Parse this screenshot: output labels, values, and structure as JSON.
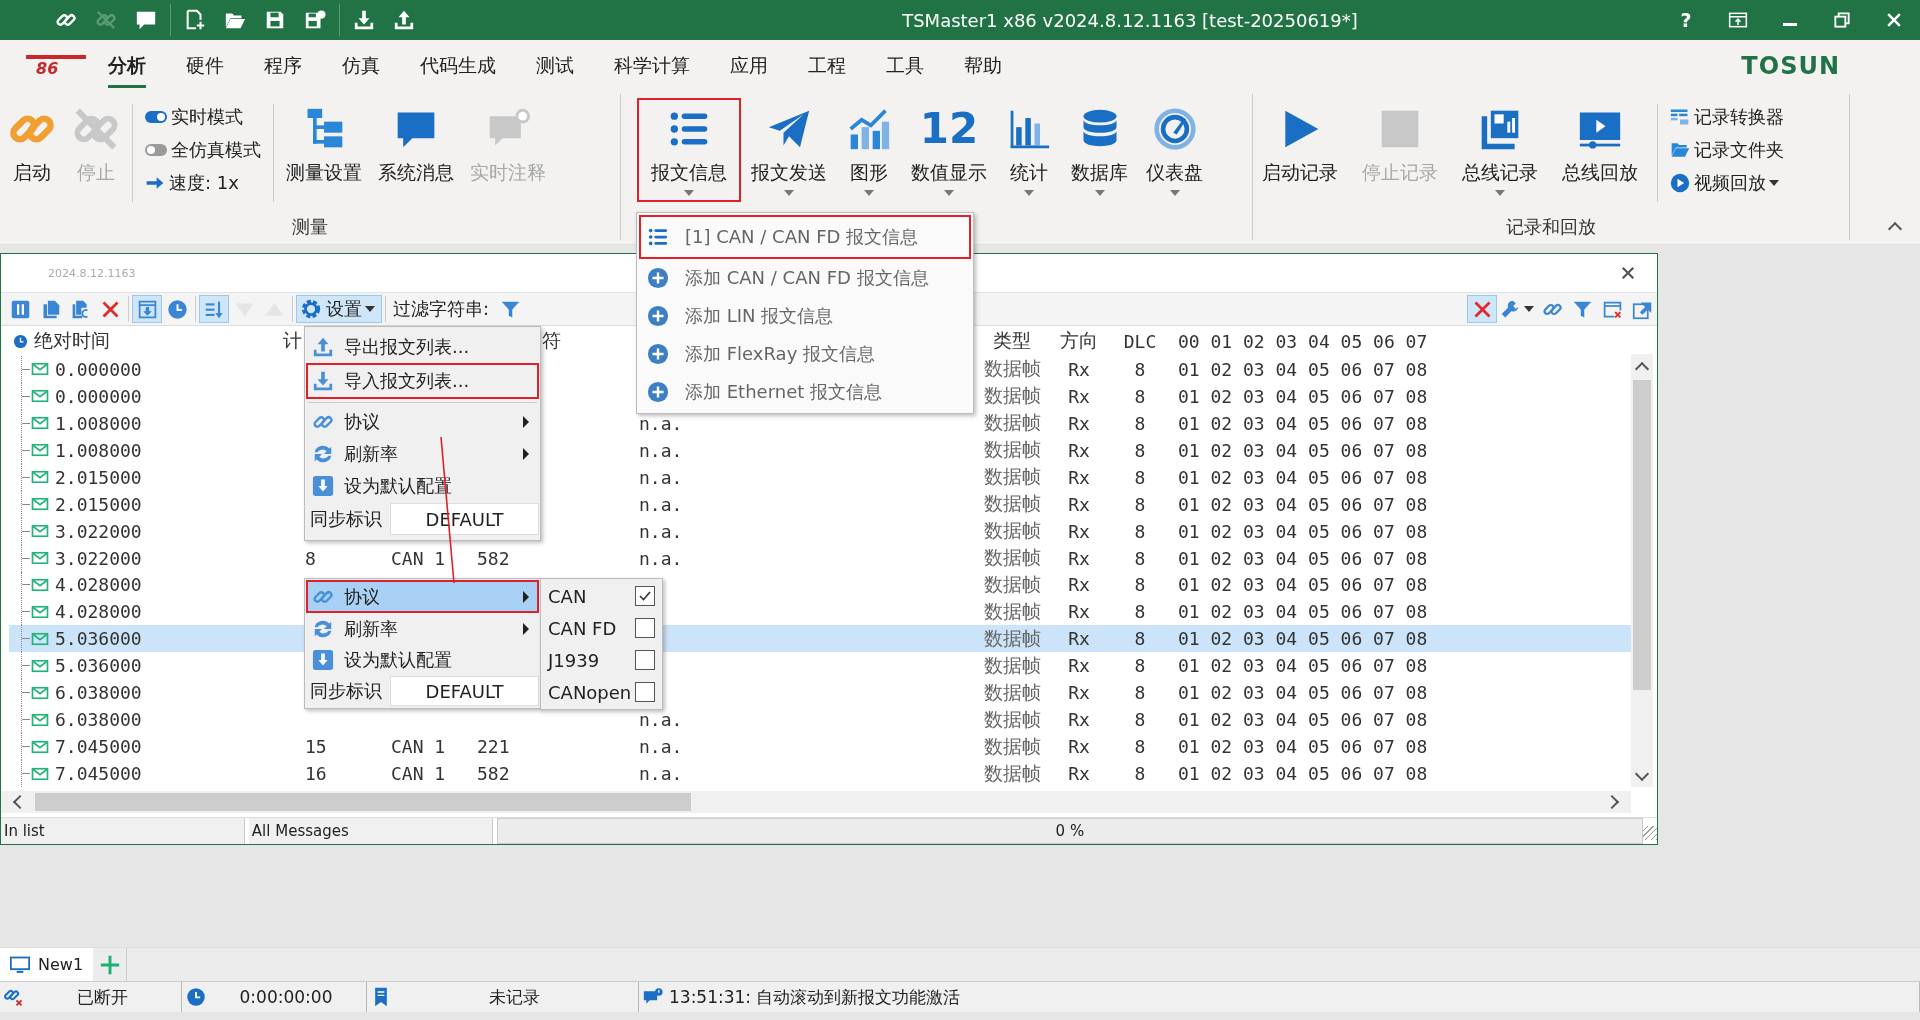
{
  "window": {
    "title": "TSMaster1 x86 v2024.8.12.1163 [test-20250619*]",
    "quick_access": [
      [
        {
          "kind": "link",
          "disabled": false
        },
        {
          "kind": "unlink",
          "disabled": true
        },
        {
          "kind": "chat",
          "disabled": false
        }
      ],
      [
        {
          "kind": "new-file",
          "disabled": false
        },
        {
          "kind": "open-folder",
          "disabled": false
        },
        {
          "kind": "save",
          "disabled": false
        },
        {
          "kind": "save-all",
          "disabled": false
        }
      ],
      [
        {
          "kind": "download",
          "disabled": false
        },
        {
          "kind": "upload",
          "disabled": false
        }
      ]
    ],
    "controls": [
      {
        "kind": "help",
        "label": "?"
      },
      {
        "kind": "pin"
      },
      {
        "kind": "minimize"
      },
      {
        "kind": "restore"
      },
      {
        "kind": "close"
      }
    ]
  },
  "menu_bar": {
    "logo_text": "86",
    "brand": "TOSUN",
    "tabs": [
      {
        "label": "分析",
        "selected": true
      },
      {
        "label": "硬件",
        "selected": false
      },
      {
        "label": "程序",
        "selected": false
      },
      {
        "label": "仿真",
        "selected": false
      },
      {
        "label": "代码生成",
        "selected": false
      },
      {
        "label": "测试",
        "selected": false
      },
      {
        "label": "科学计算",
        "selected": false
      },
      {
        "label": "应用",
        "selected": false
      },
      {
        "label": "工程",
        "selected": false
      },
      {
        "label": "工具",
        "selected": false
      },
      {
        "label": "帮助",
        "selected": false
      }
    ]
  },
  "ribbon": {
    "groups": [
      {
        "label": "测量",
        "sections": [
          [
            {
              "label": "启动",
              "kind": "link-big",
              "disabled": false,
              "dropdown": false,
              "highlighted": false
            },
            {
              "label": "停止",
              "kind": "unlink-big",
              "disabled": true,
              "dropdown": false,
              "highlighted": false
            }
          ],
          [
            {
              "entries": [
                {
                  "kind": "toggle",
                  "label": "实时模式",
                  "on": true
                },
                {
                  "kind": "toggle",
                  "label": "全仿真模式",
                  "on": false
                },
                {
                  "kind": "arrow-right",
                  "label": "速度: 1x",
                  "dropdown": false
                }
              ]
            }
          ],
          [
            {
              "label": "测量设置",
              "kind": "tree",
              "disabled": false,
              "dropdown": false,
              "highlighted": false
            },
            {
              "label": "系统消息",
              "kind": "chat",
              "disabled": false,
              "dropdown": false,
              "highlighted": false
            },
            {
              "label": "实时注释",
              "kind": "chat-info",
              "disabled": true,
              "dropdown": false,
              "highlighted": false
            }
          ]
        ]
      },
      {
        "sections": [
          [
            {
              "label": "报文信息",
              "kind": "list",
              "disabled": false,
              "dropdown": true,
              "highlighted": true
            },
            {
              "label": "报文发送",
              "kind": "plane",
              "disabled": false,
              "dropdown": true,
              "highlighted": false
            },
            {
              "label": "图形",
              "kind": "chart-line",
              "disabled": false,
              "dropdown": true,
              "highlighted": false
            },
            {
              "label": "数值显示",
              "icon_text": "12",
              "disabled": false,
              "dropdown": true,
              "highlighted": false
            },
            {
              "label": "统计",
              "kind": "bar-chart",
              "disabled": false,
              "dropdown": true,
              "highlighted": false
            },
            {
              "label": "数据库",
              "kind": "database",
              "disabled": false,
              "dropdown": true,
              "highlighted": false
            },
            {
              "label": "仪表盘",
              "kind": "gauge",
              "disabled": false,
              "dropdown": true,
              "highlighted": false
            }
          ]
        ]
      },
      {
        "label": "记录和回放",
        "sections": [
          [
            {
              "label": "启动记录",
              "kind": "play",
              "disabled": false,
              "dropdown": false,
              "highlighted": false
            },
            {
              "label": "停止记录",
              "kind": "stop",
              "disabled": true,
              "dropdown": false,
              "highlighted": false
            },
            {
              "label": "总线记录",
              "kind": "bus-record",
              "disabled": false,
              "dropdown": true,
              "highlighted": false
            },
            {
              "label": "总线回放",
              "kind": "bus-play",
              "disabled": false,
              "dropdown": false,
              "highlighted": false
            }
          ],
          [
            {
              "entries": [
                {
                  "kind": "converter",
                  "label": "记录转换器",
                  "dropdown": false
                },
                {
                  "kind": "folder",
                  "label": "记录文件夹",
                  "dropdown": false
                },
                {
                  "kind": "play-circle",
                  "label": "视频回放",
                  "dropdown": true
                }
              ]
            }
          ]
        ]
      }
    ]
  },
  "message_window": {
    "version": "2024.8.12.1163",
    "toolbar_left": [
      [
        {
          "kind": "pause",
          "pressed": false,
          "disabled": false
        },
        {
          "kind": "copy",
          "pressed": false,
          "disabled": false
        },
        {
          "kind": "copy-c",
          "pressed": false,
          "disabled": false
        },
        {
          "kind": "x",
          "pressed": false,
          "disabled": false
        }
      ],
      [
        {
          "kind": "autoscroll",
          "pressed": true,
          "disabled": false
        },
        {
          "kind": "clock",
          "pressed": false,
          "disabled": false
        }
      ],
      [
        {
          "kind": "sort",
          "pressed": true,
          "disabled": false
        },
        {
          "kind": "tri-down",
          "pressed": false,
          "disabled": true
        },
        {
          "kind": "tri-up",
          "pressed": false,
          "disabled": true
        }
      ]
    ],
    "settings_button": "设置",
    "filter_label": "过滤字符串:",
    "toolbar_right": [
      {
        "kind": "x",
        "pressed": true,
        "dropdown": false
      },
      {
        "kind": "wrench",
        "pressed": false,
        "dropdown": true
      },
      {
        "kind": "link",
        "pressed": false,
        "dropdown": false
      },
      {
        "kind": "filter",
        "pressed": false,
        "dropdown": false
      },
      {
        "kind": "window-x",
        "pressed": false,
        "dropdown": false
      },
      {
        "kind": "export",
        "pressed": false,
        "dropdown": false
      }
    ],
    "columns": {
      "time": "绝对时间",
      "count": "计",
      "name": "符",
      "type": "类型",
      "direction": "方向",
      "dlc": "DLC",
      "data": "00 01 02 03 04 05 06 07"
    },
    "rows": [
      {
        "time": "0.000000",
        "type": "数据帧",
        "direction": "Rx",
        "dlc": "8",
        "data": "01 02 03 04 05 06 07 08",
        "selected": false
      },
      {
        "time": "0.000000",
        "type": "数据帧",
        "direction": "Rx",
        "dlc": "8",
        "data": "01 02 03 04 05 06 07 08",
        "selected": false
      },
      {
        "time": "1.008000",
        "value": "n.a.",
        "type": "数据帧",
        "direction": "Rx",
        "dlc": "8",
        "data": "01 02 03 04 05 06 07 08",
        "selected": false
      },
      {
        "time": "1.008000",
        "value": "n.a.",
        "type": "数据帧",
        "direction": "Rx",
        "dlc": "8",
        "data": "01 02 03 04 05 06 07 08",
        "selected": false
      },
      {
        "time": "2.015000",
        "value": "n.a.",
        "type": "数据帧",
        "direction": "Rx",
        "dlc": "8",
        "data": "01 02 03 04 05 06 07 08",
        "selected": false
      },
      {
        "time": "2.015000",
        "value": "n.a.",
        "type": "数据帧",
        "direction": "Rx",
        "dlc": "8",
        "data": "01 02 03 04 05 06 07 08",
        "selected": false
      },
      {
        "time": "3.022000",
        "value": "n.a.",
        "type": "数据帧",
        "direction": "Rx",
        "dlc": "8",
        "data": "01 02 03 04 05 06 07 08",
        "selected": false
      },
      {
        "time": "3.022000",
        "count": "8",
        "channel": "CAN 1",
        "id": "582",
        "value": "n.a.",
        "type": "数据帧",
        "direction": "Rx",
        "dlc": "8",
        "data": "01 02 03 04 05 06 07 08",
        "selected": false
      },
      {
        "time": "4.028000",
        "type": "数据帧",
        "direction": "Rx",
        "dlc": "8",
        "data": "01 02 03 04 05 06 07 08",
        "selected": false
      },
      {
        "time": "4.028000",
        "type": "数据帧",
        "direction": "Rx",
        "dlc": "8",
        "data": "01 02 03 04 05 06 07 08",
        "selected": false
      },
      {
        "time": "5.036000",
        "type": "数据帧",
        "direction": "Rx",
        "dlc": "8",
        "data": "01 02 03 04 05 06 07 08",
        "selected": true
      },
      {
        "time": "5.036000",
        "type": "数据帧",
        "direction": "Rx",
        "dlc": "8",
        "data": "01 02 03 04 05 06 07 08",
        "selected": false
      },
      {
        "time": "6.038000",
        "type": "数据帧",
        "direction": "Rx",
        "dlc": "8",
        "data": "01 02 03 04 05 06 07 08",
        "selected": false
      },
      {
        "time": "6.038000",
        "value": "n.a.",
        "type": "数据帧",
        "direction": "Rx",
        "dlc": "8",
        "data": "01 02 03 04 05 06 07 08",
        "selected": false
      },
      {
        "time": "7.045000",
        "count": "15",
        "channel": "CAN 1",
        "id": "221",
        "value": "n.a.",
        "type": "数据帧",
        "direction": "Rx",
        "dlc": "8",
        "data": "01 02 03 04 05 06 07 08",
        "selected": false
      },
      {
        "time": "7.045000",
        "count": "16",
        "channel": "CAN 1",
        "id": "582",
        "value": "n.a.",
        "type": "数据帧",
        "direction": "Rx",
        "dlc": "8",
        "data": "01 02 03 04 05 06 07 08",
        "selected": false
      }
    ],
    "status": [
      "In list",
      "All Messages"
    ],
    "progress": "0 %"
  },
  "settings_menus": [
    {
      "sections": [
        [
          {
            "kind": "upload-tray",
            "label": "导出报文列表...",
            "submenu": false,
            "highlighted": false,
            "hovered": false
          },
          {
            "kind": "download-tray",
            "label": "导入报文列表...",
            "submenu": false,
            "highlighted": true,
            "hovered": false
          }
        ],
        [
          {
            "kind": "link",
            "label": "协议",
            "submenu": true,
            "highlighted": false,
            "hovered": false
          },
          {
            "kind": "refresh",
            "label": "刷新率",
            "submenu": true,
            "highlighted": false,
            "hovered": false
          },
          {
            "kind": "download-box",
            "label": "设为默认配置",
            "submenu": false,
            "highlighted": false,
            "hovered": false
          },
          {
            "kind": "field",
            "label": "同步标识",
            "value": "DEFAULT"
          }
        ]
      ]
    },
    {
      "sections": [
        [
          {
            "kind": "link",
            "label": "协议",
            "submenu": true,
            "highlighted": true,
            "hovered": true
          },
          {
            "kind": "refresh",
            "label": "刷新率",
            "submenu": true,
            "highlighted": false,
            "hovered": false
          },
          {
            "kind": "download-box",
            "label": "设为默认配置",
            "submenu": false,
            "highlighted": false,
            "hovered": false
          },
          {
            "kind": "field",
            "label": "同步标识",
            "value": "DEFAULT"
          }
        ]
      ],
      "submenu": [
        {
          "label": "CAN",
          "checked": true
        },
        {
          "label": "CAN FD",
          "checked": false
        },
        {
          "label": "J1939",
          "checked": false
        },
        {
          "label": "CANopen",
          "checked": false
        }
      ]
    }
  ],
  "message_info_menu": [
    {
      "label": "[1] CAN / CAN FD 报文信息",
      "kind": "list",
      "highlighted": true
    },
    {
      "label": "添加 CAN / CAN FD 报文信息",
      "kind": "plus-circle",
      "highlighted": false
    },
    {
      "label": "添加 LIN 报文信息",
      "kind": "plus-circle",
      "highlighted": false
    },
    {
      "label": "添加 FlexRay 报文信息",
      "kind": "plus-circle",
      "highlighted": false
    },
    {
      "label": "添加 Ethernet 报文信息",
      "kind": "plus-circle",
      "highlighted": false
    }
  ],
  "document_tabs": [
    {
      "label": "New1",
      "selected": true
    }
  ],
  "status_bar": [
    {
      "kind": "unlink-red",
      "text": "已断开"
    },
    {
      "kind": "clock",
      "text": "0:00:00:00"
    },
    {
      "kind": "bookmark",
      "text": "未记录"
    },
    {
      "kind": "chat-alert",
      "text": "13:51:31: 自动滚动到新报文功能激活"
    }
  ]
}
